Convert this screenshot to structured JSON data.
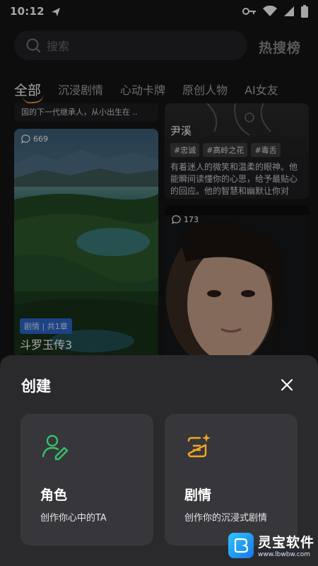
{
  "status_bar": {
    "time": "10:12"
  },
  "search": {
    "placeholder": "搜索"
  },
  "hot_label": "热搜榜",
  "tabs": [
    {
      "label": "全部"
    },
    {
      "label": "沉浸剧情"
    },
    {
      "label": "心动卡牌"
    },
    {
      "label": "原创人物"
    },
    {
      "label": "AI女友"
    }
  ],
  "feed": {
    "top_strip_text": "国的下一代继承人，从小出生在 ..",
    "card_a": {
      "count": "669",
      "badge": "剧情 | 共1章",
      "title": "斗罗玉传3",
      "hashtag": "#"
    },
    "card_b": {
      "name": "尹溪",
      "tags": [
        "#忠诚",
        "#高岭之花",
        "#毒舌"
      ],
      "desc": "有着迷人的微笑和温柔的眼神。他能瞬间读懂你的心思，给予最贴心的回应。他的智慧和幽默让你对刻..."
    },
    "card_c": {
      "count": "173"
    }
  },
  "sheet": {
    "title": "创建",
    "options": [
      {
        "title": "角色",
        "subtitle": "创作你心中的TA",
        "icon": "user-edit-icon",
        "accent": "#36c06f"
      },
      {
        "title": "剧情",
        "subtitle": "创作你的沉浸式剧情",
        "icon": "story-sparkle-icon",
        "accent": "#f5a623"
      }
    ]
  },
  "watermark": {
    "name": "灵宝软件",
    "url": "www.lbwbw.com"
  },
  "colors": {
    "background": "#141416",
    "sheet": "#2a2a2d",
    "card": "#37373b",
    "tab_underline": "#e6a43b",
    "badge": "#2c67c9"
  }
}
